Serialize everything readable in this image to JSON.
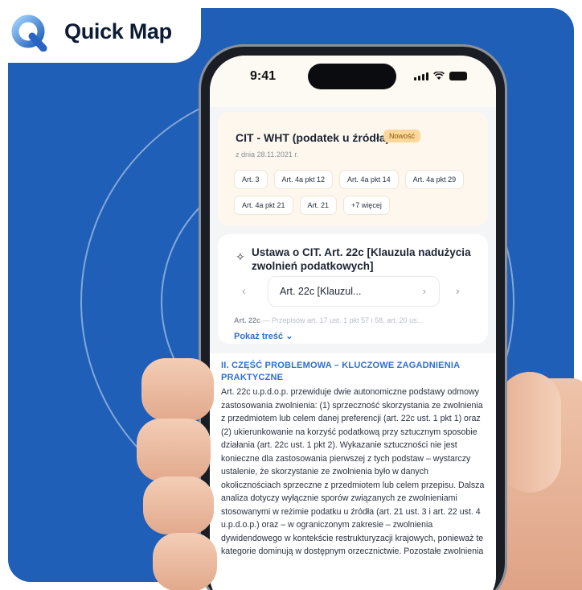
{
  "brand": {
    "name": "Quick Map"
  },
  "status_bar": {
    "time": "9:41"
  },
  "card1": {
    "title": "CIT - WHT (podatek u źródła)",
    "badge": "Nowość",
    "date": "z dnia 28.11.2021 r.",
    "chips": [
      "Art. 3",
      "Art. 4a pkt 12",
      "Art. 4a pkt 14",
      "Art. 4a pkt 29",
      "Art. 4a pkt 21",
      "Art. 21",
      "+7 więcej"
    ]
  },
  "card2": {
    "title": "Ustawa o CIT. Art. 22c [Klauzula nadużycia zwolnień podatkowych]",
    "selector_label": "Art. 22c [Klauzul...",
    "preview_lead": "Art. 22c",
    "preview_rest": " — Przepisów art. 17 ust. 1 pkt 57 i 58, art. 20 us...",
    "show_content": "Pokaż treść"
  },
  "section": {
    "title": "II. CZĘŚĆ PROBLEMOWA – KLUCZOWE ZAGADNIENIA PRAKTYCZNE",
    "body": "Art. 22c u.p.d.o.p. przewiduje dwie autonomiczne podstawy odmowy zastosowania zwolnienia: (1) sprzeczność skorzystania ze zwolnienia z przedmiotem lub celem danej preferencji (art. 22c ust. 1 pkt 1) oraz (2) ukierunkowanie na korzyść podatkową przy sztucznym sposobie działania (art. 22c ust. 1 pkt 2). Wykazanie sztuczności nie jest konieczne dla zastosowania pierwszej z tych podstaw – wystarczy ustalenie, że skorzystanie ze zwolnienia było w danych okolicznościach sprzeczne z przedmiotem lub celem przepisu. Dalsza analiza dotyczy wyłącznie sporów związanych ze zwolnieniami stosowanymi w reżimie podatku u źródła (art. 21 ust. 3 i art. 22 ust. 4 u.p.d.o.p.) oraz – w ograniczonym zakresie – zwolnienia dywidendowego w kontekście restrukturyzacji krajowych, ponieważ te kategorie dominują w dostępnym orzecznictwie. Pozostałe zwolnienia"
  },
  "colors": {
    "panel_blue": "#1f5fb8",
    "accent_blue": "#2e6fd0",
    "badge_bg": "#fbd89a"
  }
}
